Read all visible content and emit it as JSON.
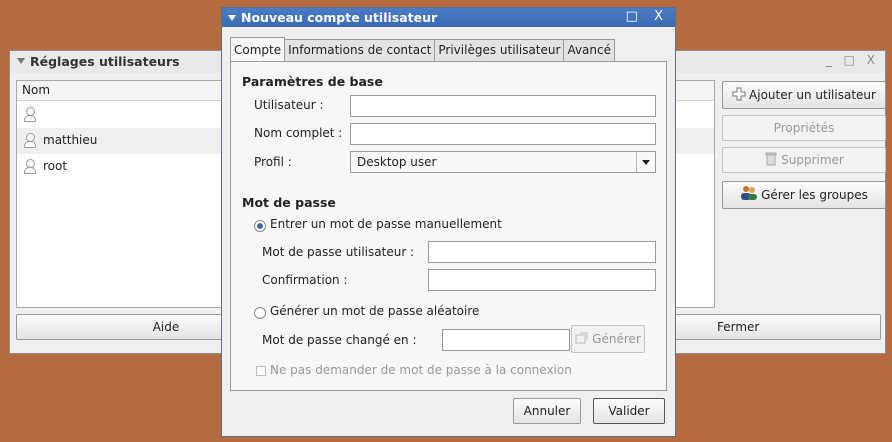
{
  "background_window": {
    "title": "Réglages utilisateurs",
    "controls": "_ □ X",
    "list_header": "Nom",
    "users": [
      "",
      "matthieu",
      "root"
    ],
    "buttons": {
      "add_user": "Ajouter un utilisateur",
      "properties": "Propriétés",
      "delete": "Supprimer",
      "manage_groups": "Gérer les groupes",
      "help": "Aide",
      "close": "Fermer"
    }
  },
  "dialog": {
    "title": "Nouveau compte utilisateur",
    "controls": "□ X",
    "tabs": [
      "Compte",
      "Informations de contact",
      "Privilèges utilisateur",
      "Avancé"
    ],
    "active_tab": "Compte",
    "basic": {
      "heading": "Paramètres de base",
      "username_label": "Utilisateur :",
      "username_value": "",
      "fullname_label": "Nom complet :",
      "fullname_value": "",
      "profile_label": "Profil :",
      "profile_value": "Desktop user"
    },
    "password": {
      "heading": "Mot de passe",
      "manual_option": "Entrer un mot de passe manuellement",
      "user_password_label": "Mot de passe utilisateur :",
      "confirmation_label": "Confirmation :",
      "random_option": "Générer un mot de passe aléatoire",
      "changed_to_label": "Mot de passe changé en :",
      "generate_button": "Générer",
      "no_ask_option": "Ne pas demander de mot de passe à la connexion"
    },
    "buttons": {
      "cancel": "Annuler",
      "ok": "Valider"
    }
  },
  "colors": {
    "desktop": "#b56a3f",
    "title_bar": "#3a6ab3",
    "window": "#efefef"
  }
}
